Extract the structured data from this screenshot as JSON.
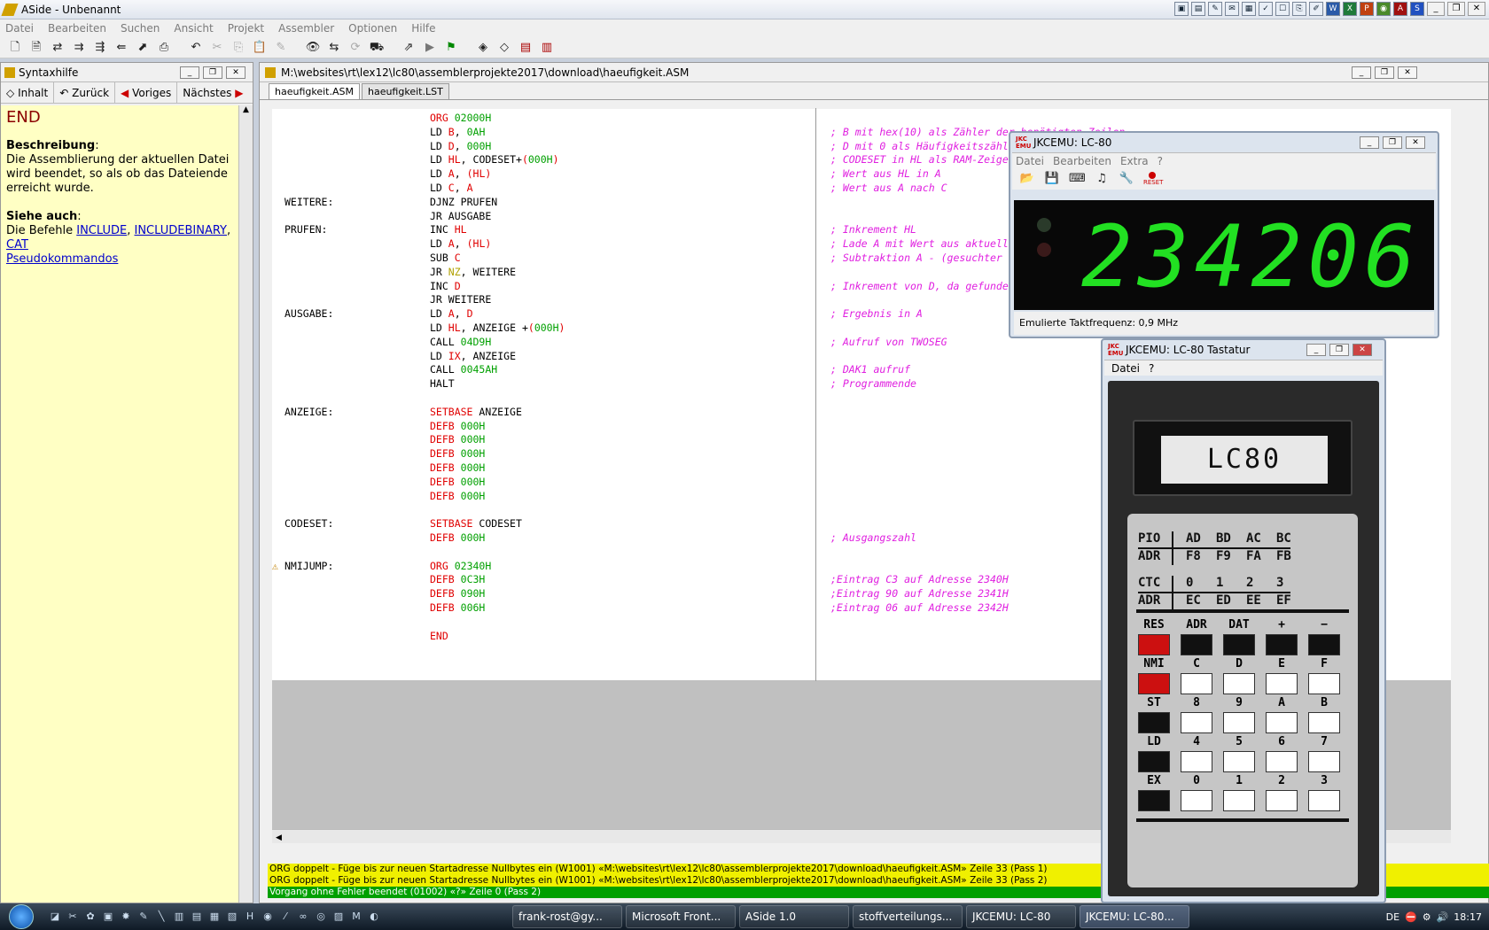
{
  "app": {
    "title": "ASide - Unbenannt",
    "menu": [
      "Datei",
      "Bearbeiten",
      "Suchen",
      "Ansicht",
      "Projekt",
      "Assembler",
      "Optionen",
      "Hilfe"
    ]
  },
  "syntax": {
    "title": "Syntaxhilfe",
    "nav": [
      "Inhalt",
      "Zurück",
      "Voriges",
      "Nächstes"
    ],
    "keyword": "END",
    "desc_head": "Beschreibung",
    "desc_colon": ":",
    "desc": "Die Assemblierung der aktuellen Datei wird beendet, so als ob das Dateiende erreicht wurde.",
    "see_head": "Siehe auch",
    "see_colon": ":",
    "see_prefix": "Die Befehle",
    "links": [
      "INCLUDE",
      "INCLUDEBINARY",
      "CAT"
    ],
    "comma": ",",
    "link2": "Pseudokommandos"
  },
  "editor": {
    "path": "M:\\websites\\rt\\lex12\\lc80\\assemblerprojekte2017\\download\\haeufigkeit.ASM",
    "tabs": [
      "haeufigkeit.ASM",
      "haeufigkeit.LST"
    ],
    "lines": [
      {
        "label": "",
        "op": "ORG",
        "args": "02000H",
        "argc": "g",
        "comment": ""
      },
      {
        "label": "",
        "op": "LD",
        "args": "B, 0AH",
        "comment": "; B mit hex(10) als Zähler der benötigten Zeilen"
      },
      {
        "label": "",
        "op": "LD",
        "args": "D, 000H",
        "comment": "; D mit 0 als Häufigkeitszähler"
      },
      {
        "label": "",
        "op": "LD",
        "args": "HL, CODESET+(000H)",
        "comment": "; CODESET in HL als RAM-Zeiger"
      },
      {
        "label": "",
        "op": "LD",
        "args": "A, (HL)",
        "comment": "; Wert aus HL in A"
      },
      {
        "label": "",
        "op": "LD",
        "args": "C, A",
        "comment": "; Wert aus A nach C"
      },
      {
        "label": "WEITERE:",
        "op": "DJNZ",
        "args": "PRUFEN",
        "comment": ""
      },
      {
        "label": "",
        "op": "JR",
        "args": "AUSGABE",
        "comment": ""
      },
      {
        "label": "PRUFEN:",
        "op": "INC",
        "args": "HL",
        "comment": "; Inkrement HL"
      },
      {
        "label": "",
        "op": "LD",
        "args": "A, (HL)",
        "comment": "; Lade A mit Wert aus aktueller Adresse"
      },
      {
        "label": "",
        "op": "SUB",
        "args": "C",
        "comment": "; Subtraktion A - (gesuchter Wert)"
      },
      {
        "label": "",
        "op": "JR",
        "args": "NZ, WEITERE",
        "comment": ""
      },
      {
        "label": "",
        "op": "INC",
        "args": "D",
        "comment": "; Inkrement von D, da gefunden"
      },
      {
        "label": "",
        "op": "JR",
        "args": "WEITERE",
        "comment": ""
      },
      {
        "label": "AUSGABE:",
        "op": "LD",
        "args": "A, D",
        "comment": "; Ergebnis in A"
      },
      {
        "label": "",
        "op": "LD",
        "args": "HL, ANZEIGE +(000H)",
        "comment": ""
      },
      {
        "label": "",
        "op": "CALL",
        "args": "04D9H",
        "comment": "; Aufruf von TWOSEG"
      },
      {
        "label": "",
        "op": "LD",
        "args": "IX, ANZEIGE",
        "comment": ""
      },
      {
        "label": "",
        "op": "CALL",
        "args": "0045AH",
        "comment": "; DAK1 aufruf"
      },
      {
        "label": "",
        "op": "HALT",
        "args": "",
        "comment": "; Programmende"
      },
      {
        "label": "",
        "op": "",
        "args": "",
        "comment": ""
      },
      {
        "label": "ANZEIGE:",
        "op": "SETBASE",
        "args": "ANZEIGE",
        "comment": ""
      },
      {
        "label": "",
        "op": "DEFB",
        "args": "000H",
        "comment": ""
      },
      {
        "label": "",
        "op": "DEFB",
        "args": "000H",
        "comment": ""
      },
      {
        "label": "",
        "op": "DEFB",
        "args": "000H",
        "comment": ""
      },
      {
        "label": "",
        "op": "DEFB",
        "args": "000H",
        "comment": ""
      },
      {
        "label": "",
        "op": "DEFB",
        "args": "000H",
        "comment": ""
      },
      {
        "label": "",
        "op": "DEFB",
        "args": "000H",
        "comment": ""
      },
      {
        "label": "",
        "op": "",
        "args": "",
        "comment": ""
      },
      {
        "label": "CODESET:",
        "op": "SETBASE",
        "args": "CODESET",
        "comment": ""
      },
      {
        "label": "",
        "op": "DEFB",
        "args": "000H",
        "comment": "; Ausgangszahl"
      },
      {
        "label": "",
        "op": "",
        "args": "",
        "comment": ""
      },
      {
        "label": "NMIJUMP:",
        "op": "ORG",
        "args": "02340H",
        "comment": ""
      },
      {
        "label": "",
        "op": "DEFB",
        "args": "0C3H",
        "comment": ";Eintrag C3 auf Adresse 2340H"
      },
      {
        "label": "",
        "op": "DEFB",
        "args": "090H",
        "comment": ";Eintrag 90 auf Adresse 2341H"
      },
      {
        "label": "",
        "op": "DEFB",
        "args": "006H",
        "comment": ";Eintrag 06 auf Adresse 2342H"
      },
      {
        "label": "",
        "op": "",
        "args": "",
        "comment": ""
      },
      {
        "label": "",
        "op": "END",
        "args": "",
        "comment": ""
      }
    ]
  },
  "messages": [
    "ORG doppelt - Füge bis zur neuen Startadresse Nullbytes ein (W1001) «M:\\websites\\rt\\lex12\\lc80\\assemblerprojekte2017\\download\\haeufigkeit.ASM» Zeile 33 (Pass 1)",
    "ORG doppelt - Füge bis zur neuen Startadresse Nullbytes ein (W1001) «M:\\websites\\rt\\lex12\\lc80\\assemblerprojekte2017\\download\\haeufigkeit.ASM» Zeile 33 (Pass 2)",
    "Vorgang ohne Fehler beendet (01002) «?» Zeile 0 (Pass 2)"
  ],
  "lc80": {
    "title": "JKCEMU: LC-80",
    "menu": [
      "Datei",
      "Bearbeiten",
      "Extra",
      "?"
    ],
    "display": "234206",
    "status": "Emulierte Taktfrequenz: 0,9 MHz",
    "reset": "RESET"
  },
  "keyboard": {
    "title": "JKCEMU: LC-80 Tastatur",
    "menu": [
      "Datei",
      "?"
    ],
    "screen": "LC80",
    "table1": [
      [
        "PIO",
        "AD",
        "BD",
        "AC",
        "BC"
      ],
      [
        "ADR",
        "F8",
        "F9",
        "FA",
        "FB"
      ]
    ],
    "table2": [
      [
        "CTC",
        "0",
        "1",
        "2",
        "3"
      ],
      [
        "ADR",
        "EC",
        "ED",
        "EE",
        "EF"
      ]
    ],
    "rows": [
      [
        "RES",
        "ADR",
        "DAT",
        "+",
        "−"
      ],
      [
        "NMI",
        "C",
        "D",
        "E",
        "F"
      ],
      [
        "ST",
        "8",
        "9",
        "A",
        "B"
      ],
      [
        "LD",
        "4",
        "5",
        "6",
        "7"
      ],
      [
        "EX",
        "0",
        "1",
        "2",
        "3"
      ]
    ]
  },
  "taskbar": {
    "tasks": [
      "frank-rost@gy...",
      "Microsoft Front...",
      "ASide 1.0",
      "stoffverteilungs...",
      "JKCEMU: LC-80",
      "JKCEMU: LC-80..."
    ],
    "lang": "DE",
    "time": "18:17"
  }
}
